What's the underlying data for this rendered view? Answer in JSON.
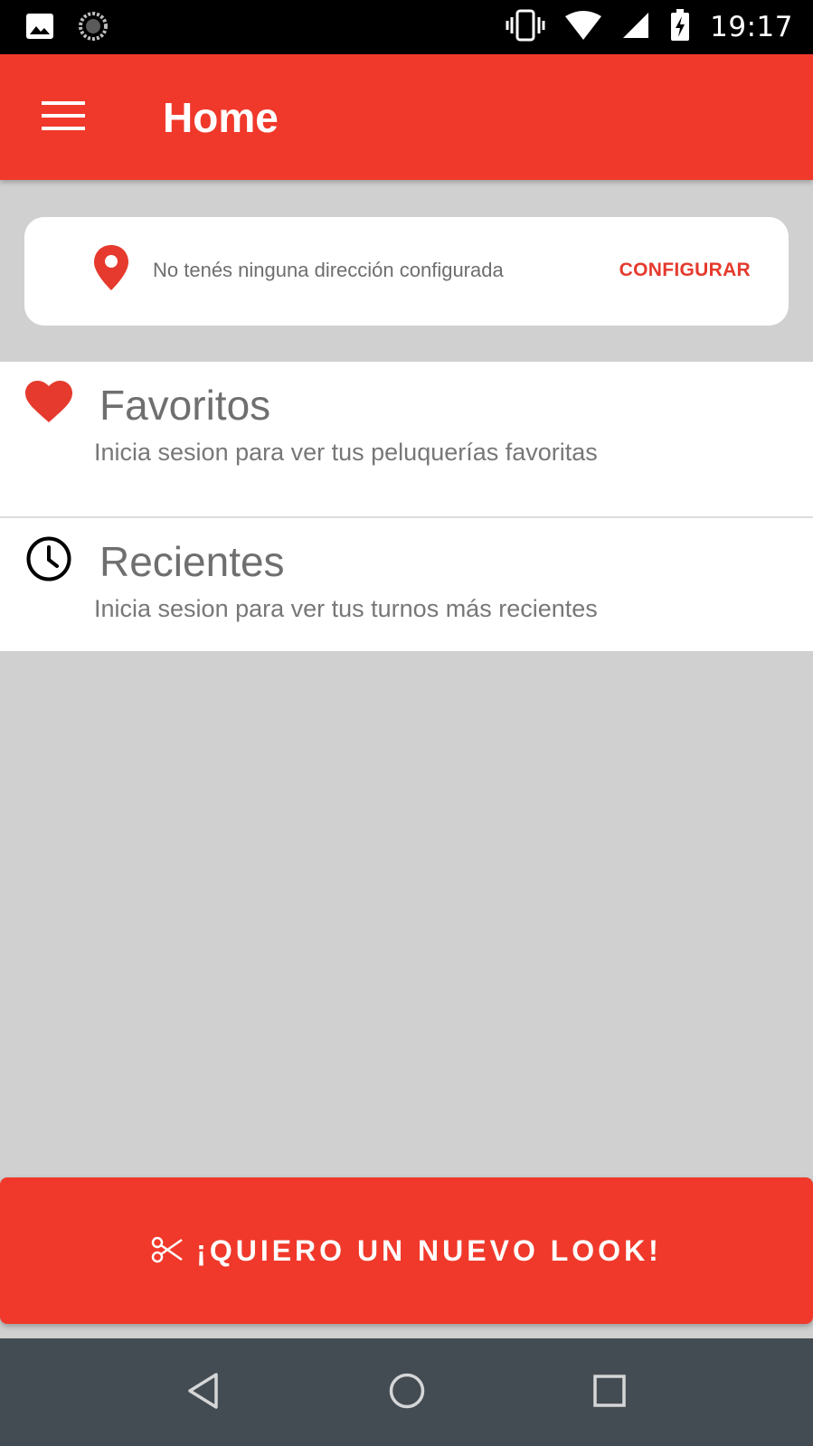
{
  "status_bar": {
    "time": "19:17",
    "left_icons": [
      "image-icon",
      "sync-icon"
    ],
    "right_icons": [
      "vibrate-icon",
      "wifi-icon",
      "signal-icon",
      "battery-charging-icon"
    ]
  },
  "app_bar": {
    "title": "Home",
    "menu_icon": "menu-icon"
  },
  "address_card": {
    "icon": "location-pin-icon",
    "message": "No tenés ninguna dirección configurada",
    "action_label": "CONFIGURAR"
  },
  "sections": [
    {
      "title": "Favoritos",
      "subtitle": "Inicia sesion para ver tus peluquerías favoritas",
      "icon": "heart-icon"
    },
    {
      "title": "Recientes",
      "subtitle": "Inicia sesion para ver tus turnos más recientes",
      "icon": "clock-icon"
    }
  ],
  "cta": {
    "label": "¡QUIERO UN NUEVO LOOK!",
    "icon": "scissors-icon"
  },
  "nav_bar": {
    "buttons": [
      "back-icon",
      "home-icon",
      "recents-icon"
    ]
  },
  "colors": {
    "primary": "#f0392b",
    "background": "#d0d0d0",
    "card": "#ffffff",
    "nav_bar": "#444c53",
    "status_bar": "#000000",
    "muted_text": "#6f6f6f"
  }
}
